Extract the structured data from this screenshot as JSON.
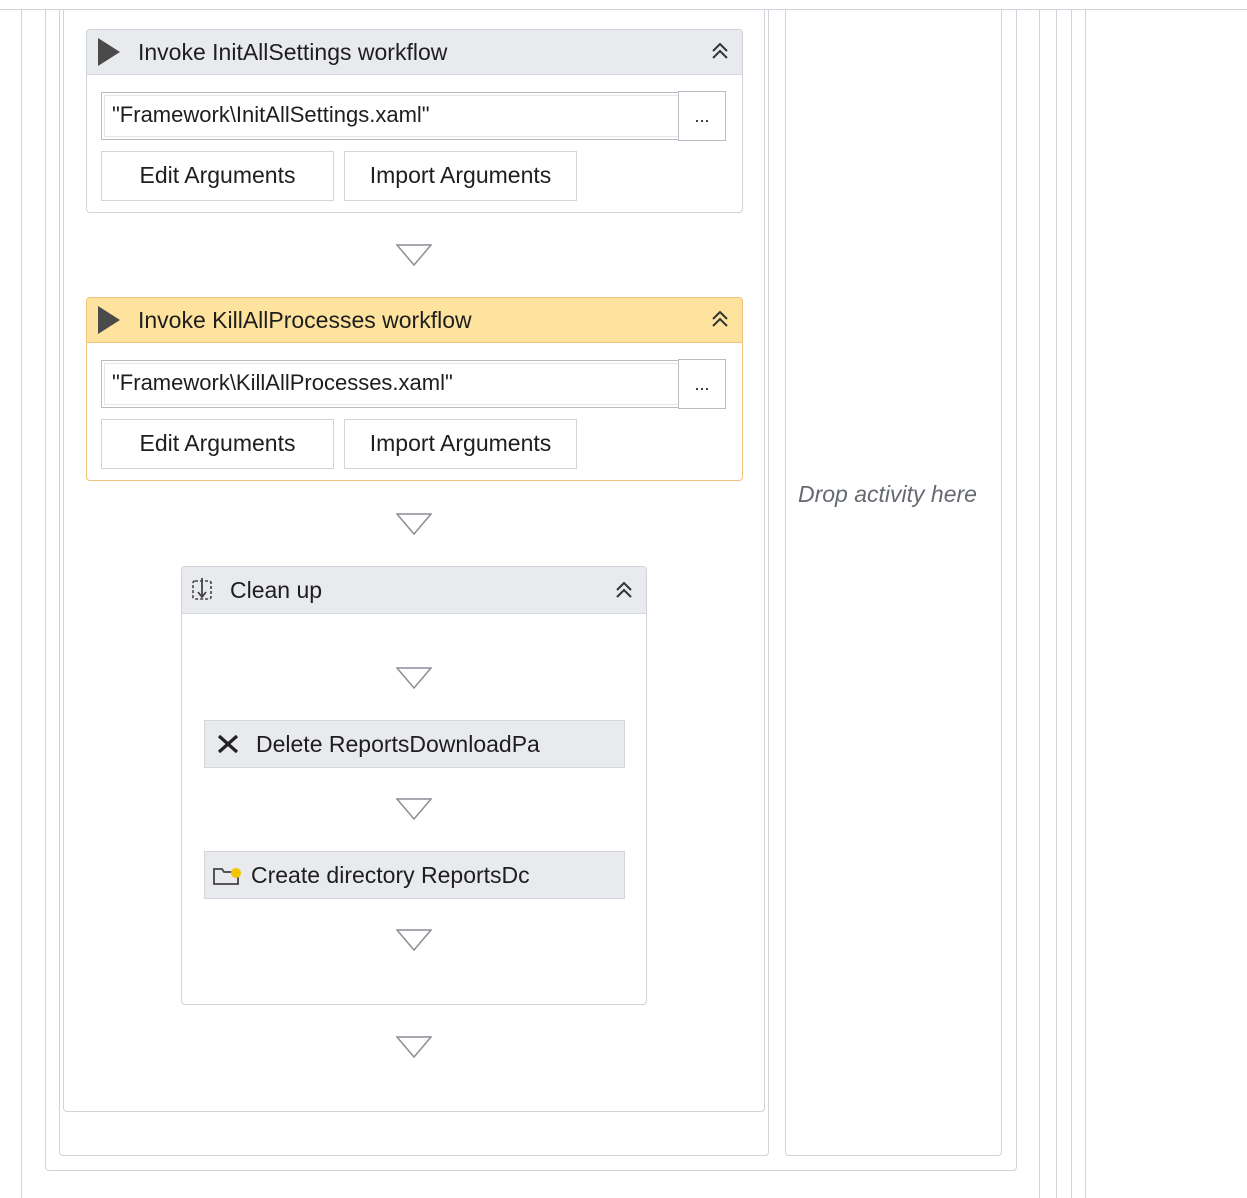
{
  "activities": {
    "init_settings": {
      "title": "Invoke InitAllSettings workflow",
      "path": "\"Framework\\InitAllSettings.xaml\"",
      "browse_label": "...",
      "edit_label": "Edit Arguments",
      "import_label": "Import Arguments"
    },
    "kill_processes": {
      "title": "Invoke KillAllProcesses workflow",
      "path": "\"Framework\\KillAllProcesses.xaml\"",
      "browse_label": "...",
      "edit_label": "Edit Arguments",
      "import_label": "Import Arguments",
      "selected": true
    },
    "clean_up": {
      "title": "Clean up",
      "children": [
        {
          "label": "Delete ReportsDownloadPa",
          "icon": "delete-icon"
        },
        {
          "label": "Create directory ReportsDc",
          "icon": "create-folder-icon"
        }
      ]
    }
  },
  "side_panel": {
    "drop_hint": "Drop activity here"
  },
  "colors": {
    "selected_header": "#fde39e",
    "selected_border": "#f0c27a",
    "header": "#e8eaee",
    "frame": "#cfd3da"
  }
}
